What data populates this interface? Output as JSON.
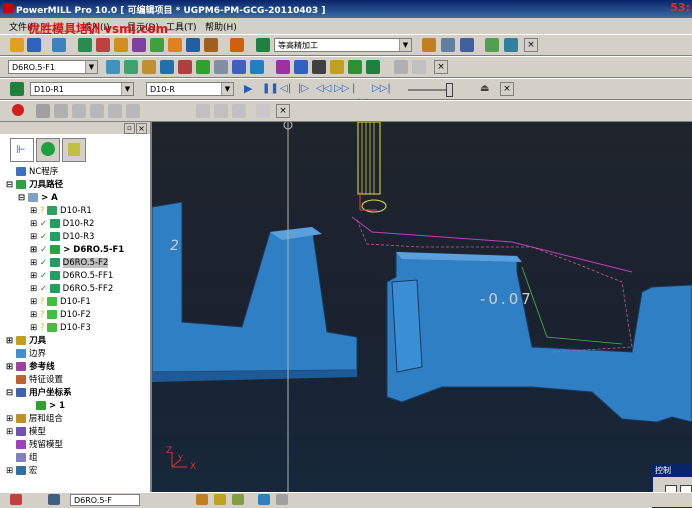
{
  "window": {
    "title": "PowerMILL Pro 10.0      [ 可编辑项目 * UGPM6-PM-GCG-20110403 ]",
    "clock": "53:"
  },
  "watermark": "优胜模具培训 vsmj.com",
  "menu": [
    "文件(F)",
    "显示(V)",
    "插入(I)",
    "显示(D)",
    "工具(T)",
    "帮助(H)"
  ],
  "toolbar1": {
    "strategy_combo": "等高精加工"
  },
  "toolbar2": {
    "tool_combo": "D6RO.5-F1"
  },
  "toolbar3": {
    "tool_combo_a": "D10-R1",
    "tool_combo_b": "D10-R"
  },
  "explorer": {
    "tree": [
      {
        "label": "NC程序",
        "level": 1,
        "icon": "nc-icon"
      },
      {
        "label": "刀具路径",
        "level": 1,
        "icon": "toolpath-icon",
        "bold": true
      },
      {
        "label": "> A",
        "level": 2,
        "icon": "folder-icon"
      },
      {
        "label": "D10-R1",
        "level": 3,
        "icon": "path-icon"
      },
      {
        "label": "D10-R2",
        "level": 3,
        "icon": "path-icon"
      },
      {
        "label": "D10-R3",
        "level": 3,
        "icon": "path-icon"
      },
      {
        "label": "> D6RO.5-F1",
        "level": 3,
        "icon": "path-icon",
        "bold": true
      },
      {
        "label": "D6RO.5-F2",
        "level": 3,
        "icon": "path-icon",
        "selected": true
      },
      {
        "label": "D6RO.5-FF1",
        "level": 3,
        "icon": "path-icon"
      },
      {
        "label": "D6RO.5-FF2",
        "level": 3,
        "icon": "path-icon"
      },
      {
        "label": "D10-F1",
        "level": 3,
        "icon": "path-icon"
      },
      {
        "label": "D10-F2",
        "level": 3,
        "icon": "path-icon"
      },
      {
        "label": "D10-F3",
        "level": 3,
        "icon": "path-icon"
      },
      {
        "label": "刀具",
        "level": 1,
        "icon": "tool-icon",
        "bold": true
      },
      {
        "label": "边界",
        "level": 1,
        "icon": "boundary-icon"
      },
      {
        "label": "参考线",
        "level": 1,
        "icon": "pattern-icon",
        "bold": true
      },
      {
        "label": "特征设置",
        "level": 1,
        "icon": "feature-icon"
      },
      {
        "label": "用户坐标系",
        "level": 1,
        "icon": "workplane-icon",
        "bold": true
      },
      {
        "label": "> 1",
        "level": 2,
        "icon": "axis-icon"
      },
      {
        "label": "层和组合",
        "level": 1,
        "icon": "layer-icon"
      },
      {
        "label": "模型",
        "level": 1,
        "icon": "model-icon"
      },
      {
        "label": "残留模型",
        "level": 1,
        "icon": "stock-icon"
      },
      {
        "label": "组",
        "level": 1,
        "icon": "group-icon"
      },
      {
        "label": "宏",
        "level": 1,
        "icon": "macro-icon"
      }
    ]
  },
  "viewport": {
    "annotation_left": "2",
    "annotation_right": "-0.07",
    "axis_x": "X",
    "axis_y": "Y",
    "axis_z": "Z"
  },
  "control_panel": {
    "title": "控制"
  },
  "status": {
    "tool_combo": "D6RO.5-F"
  }
}
